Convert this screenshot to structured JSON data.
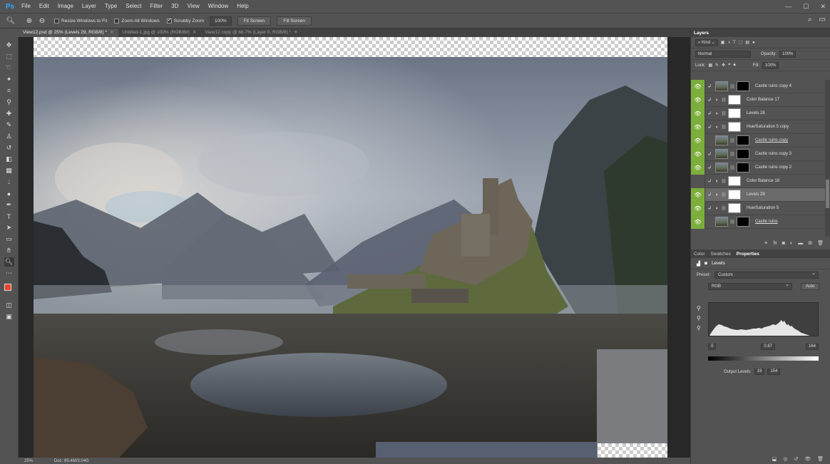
{
  "app": {
    "logo": "Ps"
  },
  "menu": [
    "File",
    "Edit",
    "Image",
    "Layer",
    "Type",
    "Select",
    "Filter",
    "3D",
    "View",
    "Window",
    "Help"
  ],
  "window_controls": [
    "—",
    "☐",
    "✕"
  ],
  "options": {
    "resize_windows": "Resize Windows to Fit",
    "zoom_all": "Zoom All Windows",
    "scrubby": "Scrubby Zoom",
    "zoom_value": "100%",
    "fit_screen": "Fit Screen",
    "fill_screen": "Fill Screen"
  },
  "tabs": [
    {
      "label": "View12.psd @ 25% (Levels 29, RGB/8) *",
      "active": true
    },
    {
      "label": "Untitled-1.jpg @ 100% (RGB/8#)",
      "active": false
    },
    {
      "label": "View12 copy @ 66.7% (Layer 0, RGB/8) *",
      "active": false
    }
  ],
  "status": {
    "zoom": "25%",
    "doc": "Doc: 65.4M/3.04G"
  },
  "layers_panel": {
    "title": "Layers",
    "kind": "Kind",
    "blend_mode": "Normal",
    "opacity_label": "Opacity:",
    "opacity": "100%",
    "lock_label": "Lock:",
    "fill_label": "Fill:",
    "fill": "100%",
    "layers": [
      {
        "name": "Castle ruins copy 4",
        "visible": true,
        "thumb": "img",
        "mask": "black",
        "clip": true,
        "underline": false,
        "selected": false
      },
      {
        "name": "Color Balance 17",
        "visible": true,
        "thumb": "adj",
        "mask": "white",
        "clip": true,
        "underline": false,
        "selected": false
      },
      {
        "name": "Levels 28",
        "visible": true,
        "thumb": "adj",
        "mask": "white",
        "clip": true,
        "underline": false,
        "selected": false
      },
      {
        "name": "Hue/Saturation 5 copy",
        "visible": true,
        "thumb": "adj",
        "mask": "white",
        "clip": true,
        "underline": false,
        "selected": false
      },
      {
        "name": "Castle ruins copy",
        "visible": true,
        "thumb": "img",
        "mask": "black",
        "clip": false,
        "underline": true,
        "selected": false
      },
      {
        "name": "Castle ruins copy 3",
        "visible": true,
        "thumb": "img",
        "mask": "black",
        "clip": true,
        "underline": false,
        "selected": false
      },
      {
        "name": "Castle ruins copy 2",
        "visible": true,
        "thumb": "img",
        "mask": "black",
        "clip": true,
        "underline": false,
        "selected": false
      },
      {
        "name": "Color Balance 18",
        "visible": false,
        "thumb": "adj",
        "mask": "white",
        "clip": true,
        "underline": false,
        "selected": false
      },
      {
        "name": "Levels 29",
        "visible": true,
        "thumb": "adj",
        "mask": "white",
        "clip": true,
        "underline": false,
        "selected": true
      },
      {
        "name": "Hue/Saturation 5",
        "visible": true,
        "thumb": "adj",
        "mask": "white",
        "clip": true,
        "underline": false,
        "selected": false
      },
      {
        "name": "Castle ruins",
        "visible": true,
        "thumb": "img",
        "mask": "black",
        "clip": false,
        "underline": true,
        "selected": false
      }
    ]
  },
  "props_tabs": [
    "Color",
    "Swatches",
    "Properties"
  ],
  "properties": {
    "title": "Levels",
    "preset_label": "Preset:",
    "preset": "Custom",
    "channel": "RGB",
    "auto": "Auto",
    "input_black": "0",
    "input_gamma": "0.87",
    "input_white": "164",
    "output_label": "Output Levels:",
    "output_black": "19",
    "output_white": "154"
  },
  "colors": {
    "accent": "#31a8ff",
    "eye_bg": "#7cae3b",
    "foreground": "#e8452a",
    "background": "#111111"
  }
}
